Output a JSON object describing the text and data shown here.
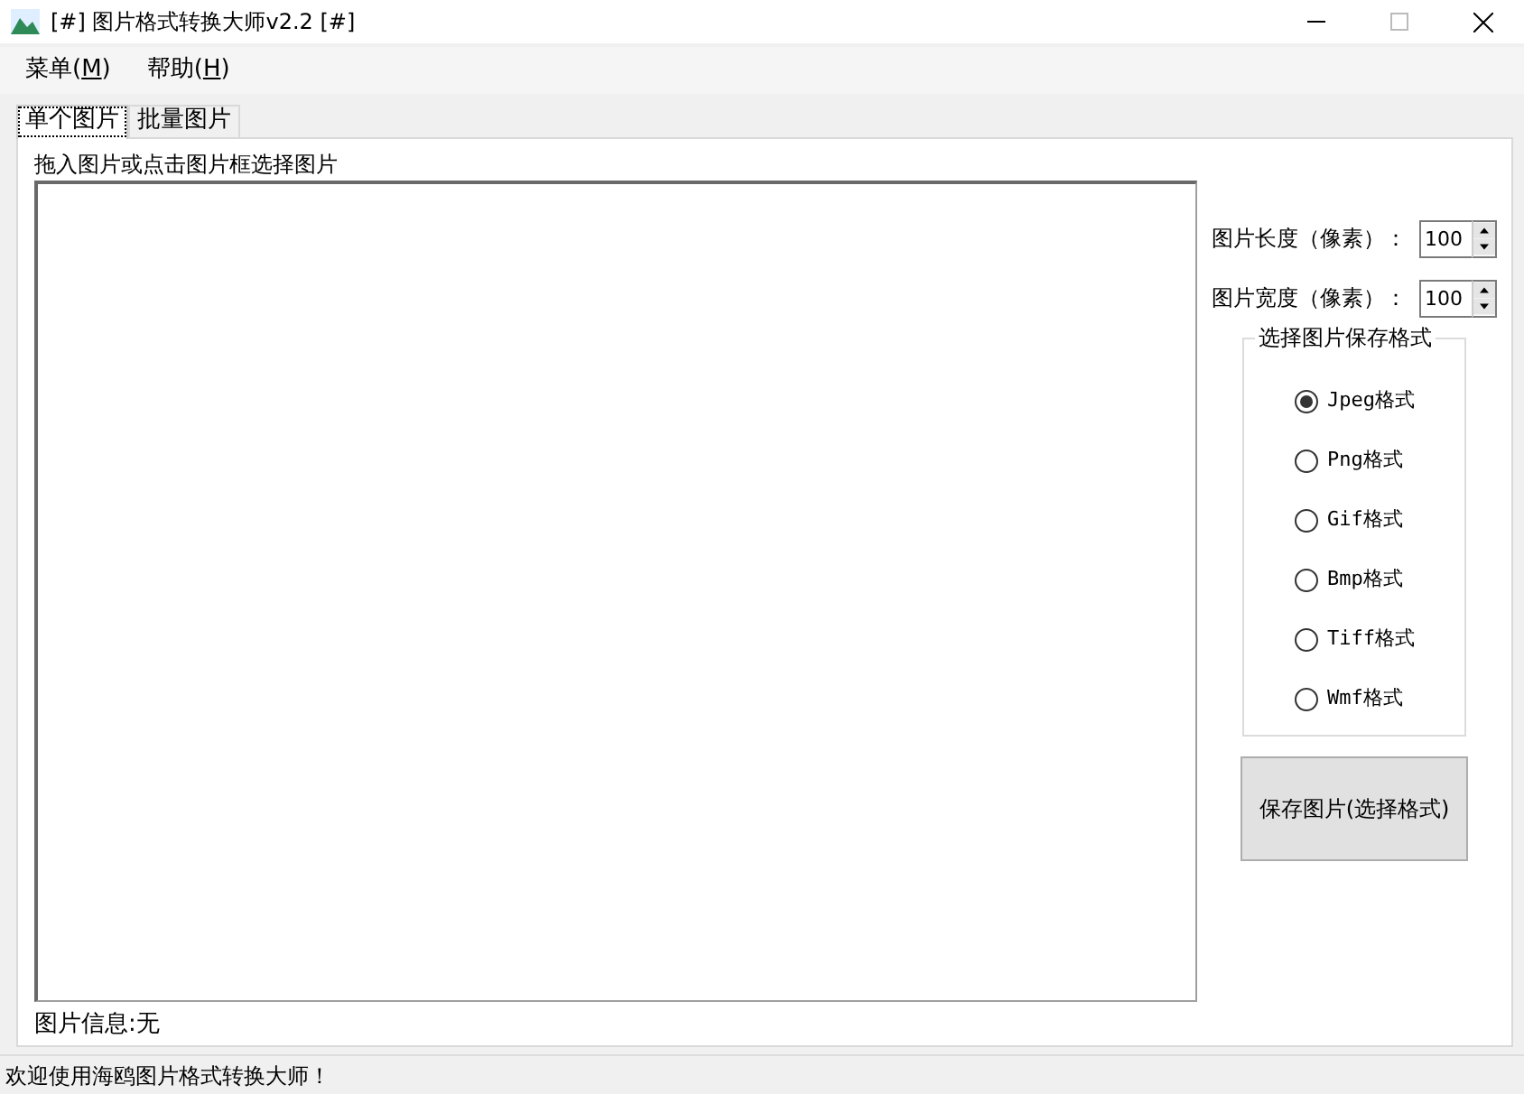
{
  "window": {
    "title": "[#] 图片格式转换大师v2.2 [#]"
  },
  "menu": [
    {
      "label": "菜单(",
      "key": "M",
      "end": ")"
    },
    {
      "label": "帮助(",
      "key": "H",
      "end": ")"
    }
  ],
  "tabs": [
    {
      "label": "单个图片",
      "selected": true
    },
    {
      "label": "批量图片",
      "selected": false
    }
  ],
  "drop_hint": "拖入图片或点击图片框选择图片",
  "size_fields": [
    {
      "label": "图片长度（像素）：",
      "value": "100"
    },
    {
      "label": "图片宽度（像素）：",
      "value": "100"
    }
  ],
  "format_group": {
    "title": "选择图片保存格式",
    "options": [
      {
        "label": "Jpeg格式",
        "selected": true
      },
      {
        "label": "Png格式",
        "selected": false
      },
      {
        "label": "Gif格式",
        "selected": false
      },
      {
        "label": "Bmp格式",
        "selected": false
      },
      {
        "label": "Tiff格式",
        "selected": false
      },
      {
        "label": "Wmf格式",
        "selected": false
      }
    ]
  },
  "save_button": "保存图片(选择格式)",
  "image_info": "图片信息:无",
  "status_bar": "欢迎使用海鸥图片格式转换大师！"
}
